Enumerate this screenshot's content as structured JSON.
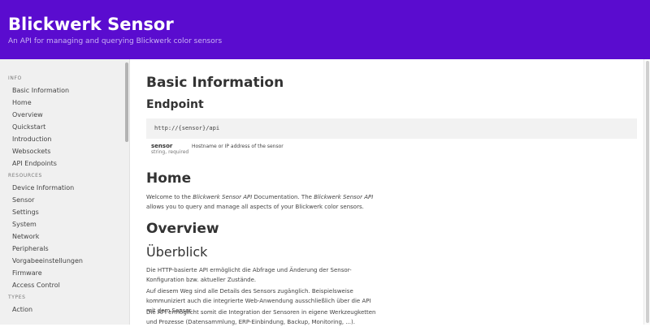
{
  "header": {
    "title": "Blickwerk Sensor",
    "subtitle": "An API for managing and querying Blickwerk color sensors"
  },
  "sidebar": {
    "sections": [
      {
        "title": "INFO",
        "items": [
          "Basic Information",
          "Home",
          "Overview",
          "Quickstart",
          "Introduction",
          "Websockets",
          "API Endpoints"
        ]
      },
      {
        "title": "RESOURCES",
        "items": [
          "Device Information",
          "Sensor",
          "Settings",
          "System",
          "Network",
          "Peripherals",
          "Vorgabeeinstellungen",
          "Firmware",
          "Access Control"
        ]
      },
      {
        "title": "TYPES",
        "items": [
          "Action"
        ]
      }
    ]
  },
  "main": {
    "basic_info_title": "Basic Information",
    "endpoint_title": "Endpoint",
    "endpoint_url": "http://{sensor}/api",
    "param": {
      "name": "sensor",
      "type": "string,",
      "required": "required",
      "description": "Hostname or IP address of the sensor"
    },
    "home_title": "Home",
    "home_text": {
      "before1": "Welcome to the ",
      "em1": "Blickwerk Sensor API",
      "between": " Documentation. The ",
      "em2": "Blickwerk Sensor API",
      "after": " allows you to query and manage all aspects of your Blickwerk color sensors."
    },
    "overview_title": "Overview",
    "ueberblick_title": "Überblick",
    "paragraphs": [
      "Die HTTP-basierte API ermöglicht die Abfrage und Änderung der Sensor-Konfiguration bzw. aktueller Zustände.",
      "Auf diesem Weg sind alle Details des Sensors zugänglich. Beispielsweise kommuniziert auch die integrierte Web-Anwendung ausschließlich über die API mit dem Sensor.",
      "Die API ermöglicht somit die Integration der Sensoren in eigene Werkzeugketten und Prozesse (Datensammlung, ERP-Einbindung, Backup, Monitoring, ...)."
    ]
  }
}
